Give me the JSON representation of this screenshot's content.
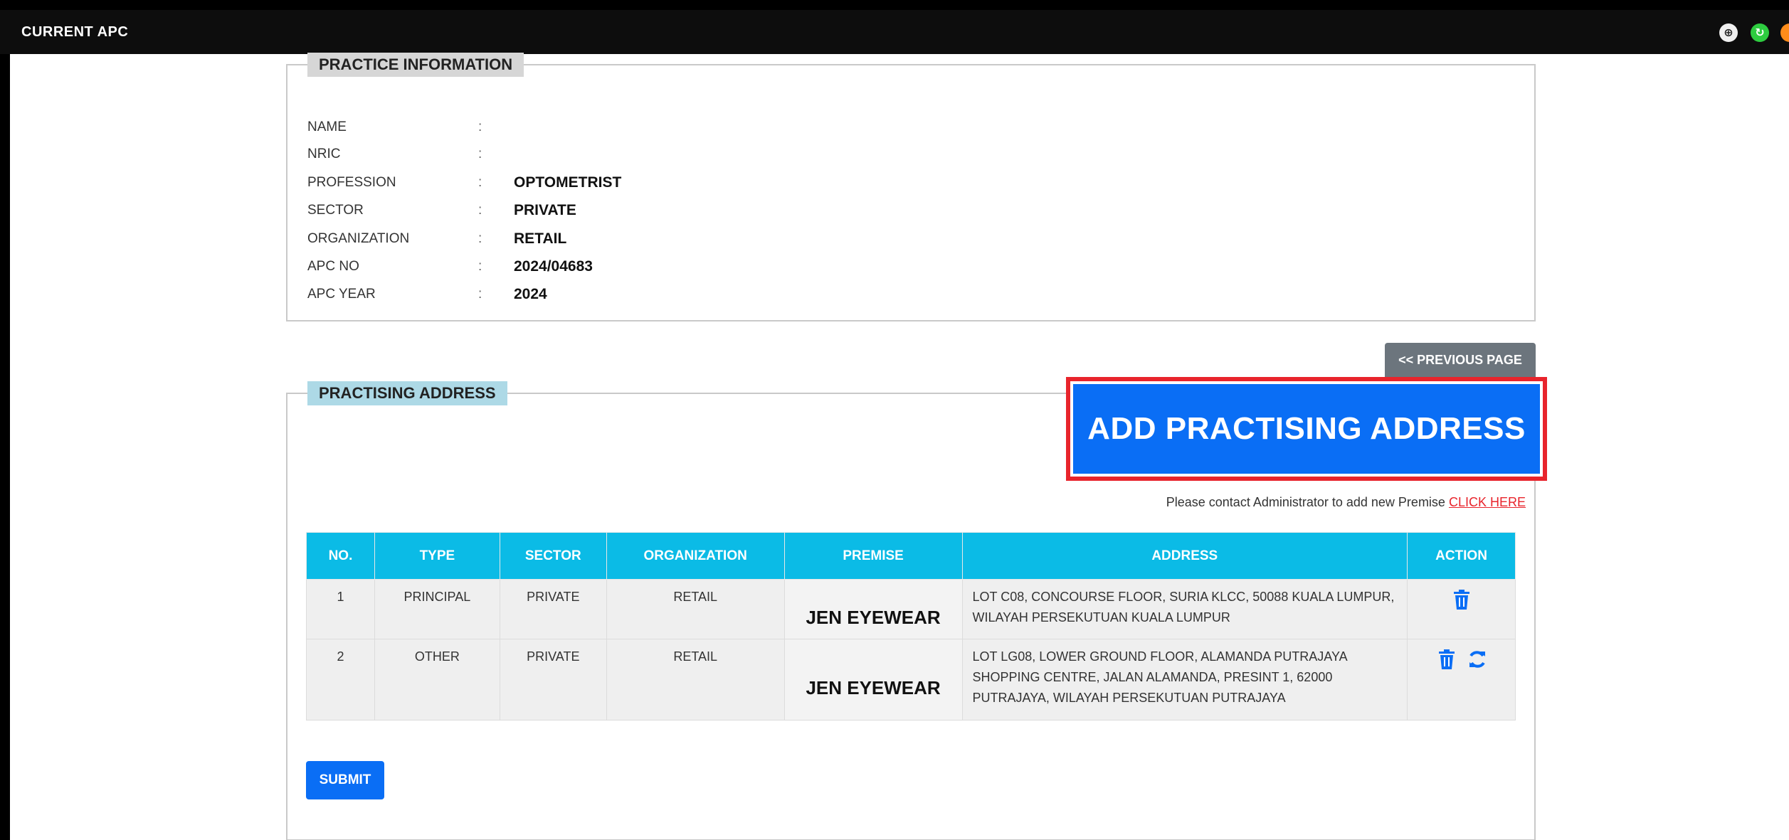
{
  "window": {
    "title": "CURRENT APC"
  },
  "practice_info": {
    "legend": "PRACTICE INFORMATION",
    "fields": [
      {
        "label": "NAME",
        "colon": ":",
        "value": ""
      },
      {
        "label": "NRIC",
        "colon": ":",
        "value": ""
      },
      {
        "label": "PROFESSION",
        "colon": ":",
        "value": "OPTOMETRIST"
      },
      {
        "label": "SECTOR",
        "colon": ":",
        "value": "PRIVATE"
      },
      {
        "label": "ORGANIZATION",
        "colon": ":",
        "value": "RETAIL"
      },
      {
        "label": "APC NO",
        "colon": ":",
        "value": "2024/04683"
      },
      {
        "label": "APC YEAR",
        "colon": ":",
        "value": "2024"
      }
    ]
  },
  "nav": {
    "previous_page": "<< PREVIOUS PAGE"
  },
  "practising_address": {
    "legend": "PRACTISING ADDRESS",
    "add_button": "ADD PRACTISING ADDRESS",
    "contact_note": "Please contact Administrator to add new Premise",
    "contact_link": "CLICK HERE",
    "table": {
      "headers": [
        "NO.",
        "TYPE",
        "SECTOR",
        "ORGANIZATION",
        "PREMISE",
        "ADDRESS",
        "ACTION"
      ],
      "rows": [
        {
          "no": "1",
          "type": "PRINCIPAL",
          "sector": "PRIVATE",
          "organization": "RETAIL",
          "premise": "JEN EYEWEAR",
          "address": "LOT C08, CONCOURSE FLOOR, SURIA KLCC, 50088 KUALA LUMPUR, WILAYAH PERSEKUTUAN KUALA LUMPUR",
          "actions": [
            "trash-icon"
          ]
        },
        {
          "no": "2",
          "type": "OTHER",
          "sector": "PRIVATE",
          "organization": "RETAIL",
          "premise": "JEN EYEWEAR",
          "address": "LOT LG08, LOWER GROUND FLOOR, ALAMANDA PUTRAJAYA SHOPPING CENTRE, JALAN ALAMANDA, PRESINT 1, 62000 PUTRAJAYA, WILAYAH PERSEKUTUAN PUTRAJAYA",
          "actions": [
            "trash-icon",
            "refresh-icon"
          ]
        }
      ]
    },
    "submit_button": "SUBMIT"
  },
  "colors": {
    "primary": "#0a6ef5",
    "table_header": "#0bbbe6",
    "highlight": "#e8242c",
    "legend_info_bg": "#d6d6d6",
    "legend_addr_bg": "#add9e6"
  }
}
